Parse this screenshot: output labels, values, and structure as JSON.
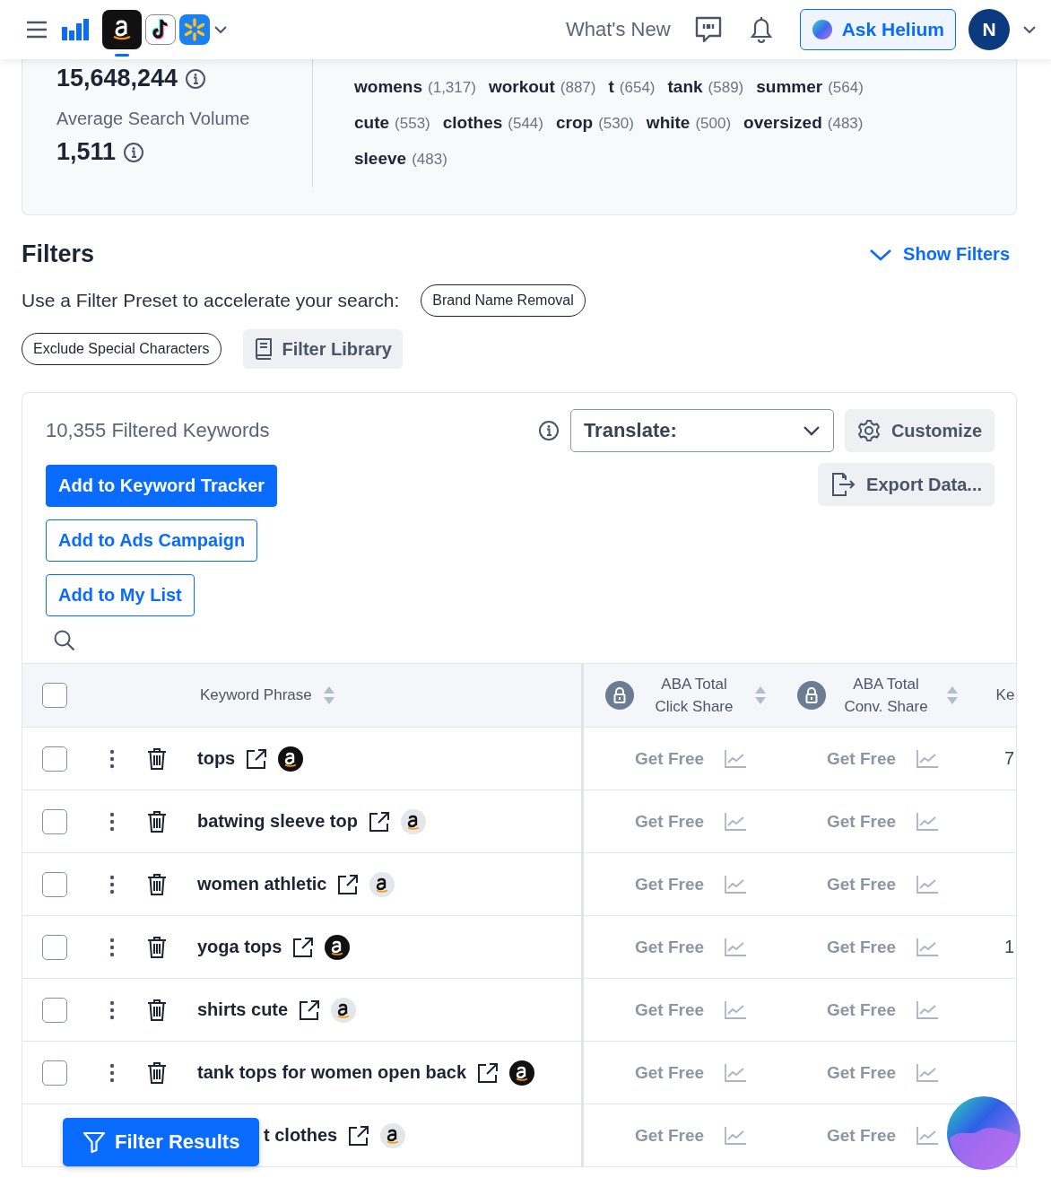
{
  "top_bar": {
    "marketplaces": [
      {
        "kind": "amazon",
        "selected": true
      },
      {
        "kind": "tiktok",
        "selected": false
      },
      {
        "kind": "walmart",
        "selected": false
      }
    ],
    "whats_new": "What's New",
    "ask_button": "Ask Helium",
    "avatar": "N"
  },
  "summary": {
    "total_volume": "15,648,244",
    "avg_label": "Average Search Volume",
    "avg_volume": "1,511",
    "words": [
      {
        "word": "womens",
        "count": "(1,317)"
      },
      {
        "word": "workout",
        "count": "(887)"
      },
      {
        "word": "t",
        "count": "(654)"
      },
      {
        "word": "tank",
        "count": "(589)"
      },
      {
        "word": "summer",
        "count": "(564)"
      },
      {
        "word": "cute",
        "count": "(553)"
      },
      {
        "word": "clothes",
        "count": "(544)"
      },
      {
        "word": "crop",
        "count": "(530)"
      },
      {
        "word": "white",
        "count": "(500)"
      },
      {
        "word": "oversized",
        "count": "(483)"
      },
      {
        "word": "sleeve",
        "count": "(483)"
      }
    ]
  },
  "filters": {
    "title": "Filters",
    "toggle": "Show Filters",
    "preset_label": "Use a Filter Preset to accelerate your search:",
    "presets": [
      "Brand Name Removal",
      "Exclude Special Characters"
    ],
    "library_button": "Filter Library"
  },
  "results": {
    "count": "10,355 Filtered Keywords",
    "translate": "Translate:",
    "customize": "Customize",
    "export": "Export Data...",
    "actions": [
      {
        "label": "Add to Keyword Tracker",
        "kind": "primary"
      },
      {
        "label": "Add to Ads Campaign",
        "kind": "outline"
      },
      {
        "label": "Add to My List",
        "kind": "outline"
      }
    ],
    "all_checked": false,
    "columns": [
      {
        "label": "Keyword Phrase",
        "locked": false
      },
      {
        "label": "ABA Total Click Share",
        "locked": true
      },
      {
        "label": "ABA Total Conv. Share",
        "locked": true
      },
      {
        "label": "Ke",
        "locked": false
      }
    ],
    "rows": [
      {
        "checked": false,
        "covered": false,
        "keyword": "tops",
        "badge_dark": true,
        "col_1": "Get Free",
        "col_2": "Get Free",
        "col_3": "7"
      },
      {
        "checked": false,
        "covered": false,
        "keyword": "batwing sleeve top",
        "badge_dark": false,
        "col_1": "Get Free",
        "col_2": "Get Free"
      },
      {
        "checked": false,
        "covered": false,
        "keyword": "women athletic",
        "badge_dark": false,
        "col_1": "Get Free",
        "col_2": "Get Free"
      },
      {
        "checked": false,
        "covered": false,
        "keyword": "yoga tops",
        "badge_dark": true,
        "col_1": "Get Free",
        "col_2": "Get Free",
        "col_3": "1"
      },
      {
        "checked": false,
        "covered": false,
        "keyword": "shirts cute",
        "badge_dark": false,
        "col_1": "Get Free",
        "col_2": "Get Free"
      },
      {
        "checked": false,
        "covered": false,
        "keyword": "tank tops for women open back",
        "badge_dark": true,
        "col_1": "Get Free",
        "col_2": "Get Free"
      },
      {
        "covered": true,
        "keyword": "t clothes",
        "badge_dark": false,
        "col_1": "Get Free",
        "col_2": "Get Free"
      }
    ],
    "filter_button": "Filter Results"
  }
}
